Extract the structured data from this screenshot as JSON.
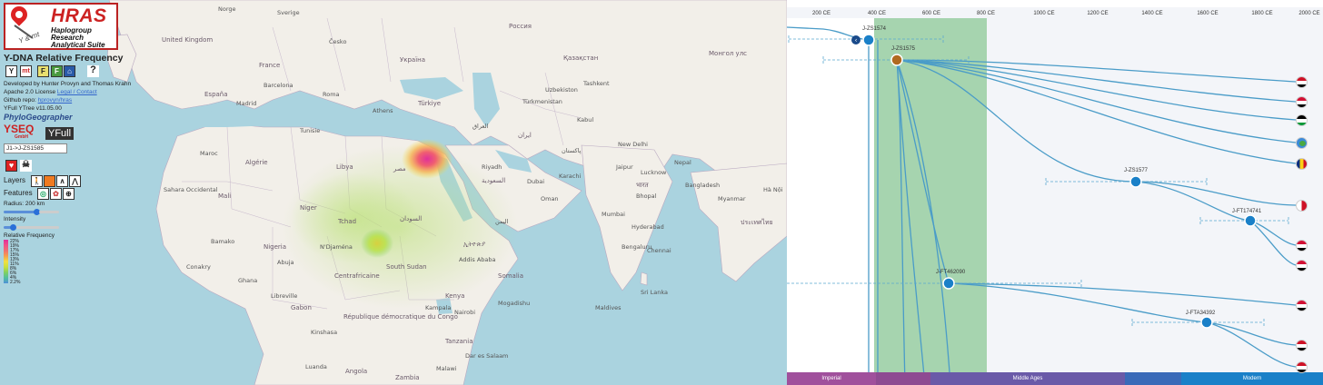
{
  "panel": {
    "logo_title": "HRAS",
    "logo_sub1": "Haplogroup",
    "logo_sub2": "Research",
    "logo_sub3": "Analytical Suite",
    "logo_ymt": "Y & mt",
    "title": "Y-DNA Relative Frequency",
    "btn_y": "Y",
    "btn_mt": "mt",
    "btn_f1": "F",
    "btn_f2": "F",
    "btn_help": "?",
    "dev_text": "Developed by Hunter Provyn and Thomas Krahn",
    "license_text": "Apache 2.0 License",
    "license_link": "Legal / Contact",
    "github_text": "Github repo:",
    "github_link": "hprovyn/hras",
    "yfull_version": "YFull YTree v11.05.00",
    "phylo": "PhyloGeographer",
    "yseq": "YSEQ",
    "yseq_sub": "GmbH",
    "yfull": "YFull",
    "search_value": "J1->J-ZS1585",
    "layers_label": "Layers",
    "features_label": "Features",
    "radius_label": "Radius: 200 km",
    "intensity_label": "Intensity",
    "relfreq_label": "Relative Frequency",
    "legend": [
      "22%",
      "19%",
      "17%",
      "15%",
      "13%",
      "11%",
      "8%",
      "6%",
      "4%",
      "2.2%"
    ]
  },
  "map": {
    "places": [
      {
        "t": "Norge",
        "c": false
      },
      {
        "t": "Sverige",
        "c": false
      },
      {
        "t": "United Kingdom",
        "c": true
      },
      {
        "t": "Česko",
        "c": false
      },
      {
        "t": "Україна",
        "c": true
      },
      {
        "t": "Россия",
        "c": true
      },
      {
        "t": "Қазақстан",
        "c": true
      },
      {
        "t": "Монгол улс",
        "c": true
      },
      {
        "t": "France",
        "c": true
      },
      {
        "t": "Türkiye",
        "c": true
      },
      {
        "t": "Uzbekiston",
        "c": false
      },
      {
        "t": "Türkmenistan",
        "c": false
      },
      {
        "t": "Tashkent",
        "c": false
      },
      {
        "t": "España",
        "c": true
      },
      {
        "t": "Barcelona",
        "c": false
      },
      {
        "t": "Madrid",
        "c": false
      },
      {
        "t": "Roma",
        "c": false
      },
      {
        "t": "Athens",
        "c": false
      },
      {
        "t": "Tunisie",
        "c": false
      },
      {
        "t": "Algérie",
        "c": true
      },
      {
        "t": "Maroc",
        "c": false
      },
      {
        "t": "Libya",
        "c": true
      },
      {
        "t": "مصر",
        "c": true
      },
      {
        "t": "العراق",
        "c": false
      },
      {
        "t": "ایران",
        "c": true
      },
      {
        "t": "پاکستان",
        "c": false
      },
      {
        "t": "Kabul",
        "c": false
      },
      {
        "t": "New Delhi",
        "c": false
      },
      {
        "t": "Jaipur",
        "c": false
      },
      {
        "t": "Lucknow",
        "c": false
      },
      {
        "t": "भारत",
        "c": true
      },
      {
        "t": "Bhopal",
        "c": false
      },
      {
        "t": "Mumbai",
        "c": false
      },
      {
        "t": "Hyderabad",
        "c": false
      },
      {
        "t": "Bengaluru",
        "c": false
      },
      {
        "t": "Chennai",
        "c": false
      },
      {
        "t": "Karachi",
        "c": false
      },
      {
        "t": "Riyadh",
        "c": false
      },
      {
        "t": "السعودية",
        "c": true
      },
      {
        "t": "Dubai",
        "c": false
      },
      {
        "t": "Oman",
        "c": false
      },
      {
        "t": "اليمن",
        "c": false
      },
      {
        "t": "Mali",
        "c": true
      },
      {
        "t": "Niger",
        "c": true
      },
      {
        "t": "Tchad",
        "c": true
      },
      {
        "t": "السودان",
        "c": true
      },
      {
        "t": "N'Djaména",
        "c": false
      },
      {
        "t": "Bamako",
        "c": false
      },
      {
        "t": "Nigeria",
        "c": true
      },
      {
        "t": "Abuja",
        "c": false
      },
      {
        "t": "ኢትዮጵያ",
        "c": true
      },
      {
        "t": "Addis Ababa",
        "c": false
      },
      {
        "t": "South Sudan",
        "c": true
      },
      {
        "t": "Somalia",
        "c": true
      },
      {
        "t": "Centrafricaine",
        "c": true
      },
      {
        "t": "Kenya",
        "c": true
      },
      {
        "t": "Nairobi",
        "c": false
      },
      {
        "t": "Gabon",
        "c": true
      },
      {
        "t": "Libreville",
        "c": false
      },
      {
        "t": "Kinshasa",
        "c": false
      },
      {
        "t": "République démocratique du Congo",
        "c": true
      },
      {
        "t": "Tanzania",
        "c": true
      },
      {
        "t": "Dar es Salaam",
        "c": false
      },
      {
        "t": "Angola",
        "c": true
      },
      {
        "t": "Luanda",
        "c": false
      },
      {
        "t": "Zambia",
        "c": true
      },
      {
        "t": "Malawi",
        "c": false
      },
      {
        "t": "Conakry",
        "c": false
      },
      {
        "t": "Ghana",
        "c": false
      },
      {
        "t": "Nepal",
        "c": false
      },
      {
        "t": "Bangladesh",
        "c": false
      },
      {
        "t": "Myanmar",
        "c": false
      },
      {
        "t": "ประเทศไทย",
        "c": true
      },
      {
        "t": "Hà Nội",
        "c": false
      },
      {
        "t": "Sri Lanka",
        "c": false
      },
      {
        "t": "Maldives",
        "c": false
      },
      {
        "t": "Mogadishu",
        "c": false
      },
      {
        "t": "Kampala",
        "c": false
      },
      {
        "t": "Sahara Occidental",
        "c": false
      }
    ]
  },
  "tree": {
    "ticks": [
      "200 CE",
      "400 CE",
      "600 CE",
      "800 CE",
      "1000 CE",
      "1200 CE",
      "1400 CE",
      "1600 CE",
      "1800 CE",
      "2000 CE"
    ],
    "nodes": [
      "J-ZS1574",
      "J-ZS1575",
      "J-ZS1577",
      "J-FT174741",
      "J-FT462090",
      "J-FTA34392"
    ],
    "eras": [
      "Imperial",
      "Middle Ages",
      "Modern"
    ],
    "colors": {
      "band": "#8cc896",
      "line": "#4a9cc8",
      "imperial": "#a0509c",
      "middle": "#6a5aa8",
      "modern": "#1a80c8"
    }
  }
}
